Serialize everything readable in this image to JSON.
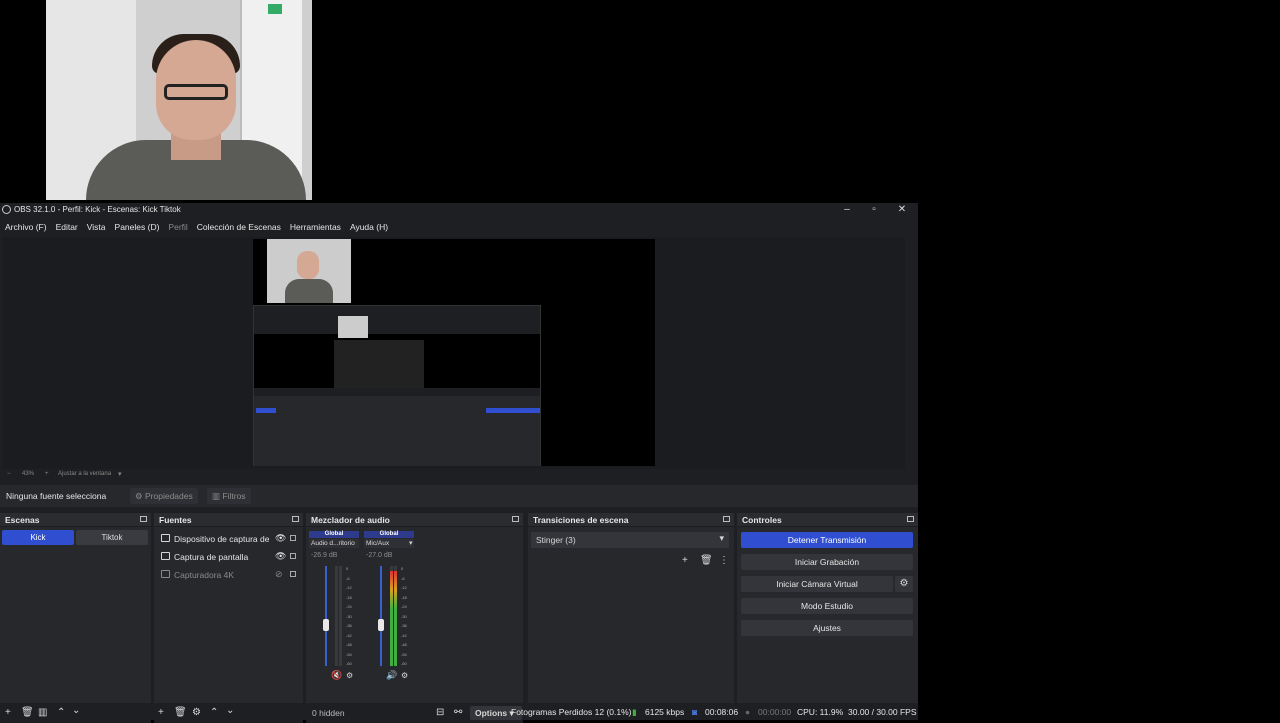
{
  "window": {
    "title": "OBS 32.1.0 - Perfil: Kick - Escenas: Kick Tiktok"
  },
  "menu": [
    "Archivo (F)",
    "Editar",
    "Vista",
    "Paneles (D)",
    "Perfil",
    "Colección de Escenas",
    "Herramientas",
    "Ayuda (H)"
  ],
  "zoom": {
    "minus": "−",
    "level": "43%",
    "plus": "+",
    "fit": "Ajustar a la ventana"
  },
  "source_bar": {
    "label": "Ninguna fuente selecciona",
    "properties": "Propiedades",
    "filters": "Filtros"
  },
  "docks": {
    "scenes": {
      "title": "Escenas",
      "items": [
        "Kick",
        "Tiktok"
      ]
    },
    "sources": {
      "title": "Fuentes",
      "items": [
        "Dispositivo de captura de",
        "Captura de pantalla",
        "Capturadora 4K"
      ]
    },
    "mixer": {
      "title": "Mezclador de audio",
      "hidden": "0 hidden",
      "options": "Options",
      "channels": [
        {
          "group": "Global",
          "name": "Audio d...ritorio",
          "db": "-26.9 dB",
          "level": 0.0
        },
        {
          "group": "Global",
          "name": "Mic/Aux",
          "db": "-27.0 dB",
          "level": 0.95
        }
      ],
      "scale": [
        "0",
        "-6",
        "-12",
        "-18",
        "-24",
        "-30",
        "-36",
        "-42",
        "-48",
        "-54",
        "-60"
      ]
    },
    "transitions": {
      "title": "Transiciones de escena",
      "selected": "Stinger (3)"
    },
    "controls": {
      "title": "Controles",
      "buttons": [
        "Detener Transmisión",
        "Iniciar Grabación",
        "Iniciar Cámara Virtual",
        "Modo Estudio",
        "Ajustes"
      ]
    }
  },
  "status": {
    "dropped": "Fotogramas Perdidos 12 (0.1%)",
    "bitrate": "6125 kbps",
    "stream_time": "00:08:06",
    "rec_time": "00:00:00",
    "cpu": "CPU: 11.9%",
    "fps": "30.00 / 30.00 FPS"
  },
  "colors": {
    "accent": "#2f4fd0",
    "bg": "#1e1f22",
    "dock": "#27282c"
  }
}
